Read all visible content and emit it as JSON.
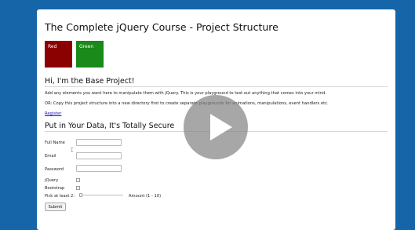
{
  "page": {
    "title": "The Complete jQuery Course - Project Structure",
    "boxes": {
      "red": "Red",
      "green": "Green"
    }
  },
  "intro": {
    "heading": "Hi, I'm the Base Project!",
    "line1": "Add any elements you want here to manipulate them with jQuery. This is your playground to test out anything that comes into your mind.",
    "line2": "OR: Copy this project structure into a new directory first to create separate playgrounds for animations, manipulations, event handlers etc.",
    "register_link": "Register"
  },
  "form": {
    "heading": "Put in Your Data, It's Totally Secure",
    "fields": {
      "full_name": {
        "label": "Full Name",
        "value": ""
      },
      "email": {
        "label": "Email",
        "value": ""
      },
      "password": {
        "label": "Password",
        "value": ""
      }
    },
    "checkboxes": {
      "jquery": {
        "label": "jQuery",
        "checked": false
      },
      "bootstrap": {
        "label": "Bootstrap",
        "checked": false
      }
    },
    "slider": {
      "label": "Pick at least 2:",
      "amount_label": "Amount (1 - 10)"
    },
    "submit_label": "Submit"
  },
  "colors": {
    "background": "#1565a8",
    "red_box": "#8b0000",
    "green_box": "#1a8a1a",
    "link": "#1a0dab"
  },
  "overlay": {
    "icon": "play-icon"
  }
}
